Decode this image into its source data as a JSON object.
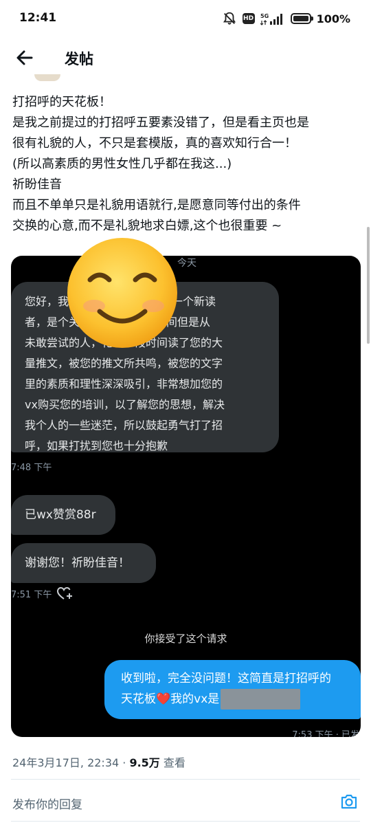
{
  "status_bar": {
    "time": "12:41",
    "network": "5G",
    "battery": "100%",
    "icons": [
      "bell-off-icon",
      "hd-icon",
      "signal-icon",
      "battery-icon"
    ]
  },
  "header": {
    "title": "发帖",
    "back_icon": "arrow-left-icon"
  },
  "post": {
    "text_lines": [
      "打招呼的天花板！",
      "是我之前提过的打招呼五要素没错了，但是看主页也是",
      "很有礼貌的人，不只是套模版，真的喜欢知行合一！",
      "(所以高素质的男性女性几乎都在我这...)",
      "祈盼佳音",
      "而且不单单只是礼貌用语就行,是愿意同等付出的条件",
      "交换的心意,而不是礼貌地求白嫖,这个也很重要 ~"
    ],
    "date": "24年3月17日, 22:34 · ",
    "views_count": "9.5万",
    "views_label": " 查看"
  },
  "chat": {
    "date_label": "今天",
    "message1_lines": [
      "您好，我",
      "者，是个关注",
      "未敢尝试的人，花了一段时间读了您的大",
      "量推文，被您的推文所共鸣，被您的文字",
      "里的素质和理性深深吸引，非常想加您的",
      "vx购买您的培训，以了解您的思想，解决",
      "我个人的一些迷茫，所以鼓起勇气打了招",
      "呼，如果打扰到您也十分抱歉"
    ],
    "message1_fragments": [
      "久的一个新读",
      "关知识很长时间但是从"
    ],
    "message1_time": "7:48 下午",
    "message2": "已wx赞赏88r",
    "message3": "谢谢您！祈盼佳音！",
    "message3_time": "7:51 下午",
    "accepted_notice": "你接受了这个请求",
    "reply_line1": "收到啦，完全没问题！这简直是打招呼的",
    "reply_line2_a": "天花板",
    "reply_heart": "❤️",
    "reply_line2_b": "我的vx是",
    "reply_time": "7:53 下午 · 已发",
    "emoji_icon": "smiling-face-emoji"
  },
  "reply_bar": {
    "placeholder": "发布你的回复",
    "camera_icon": "camera-icon"
  },
  "colors": {
    "accent": "#1d9bf0",
    "chat_bubble": "#2f3336",
    "chat_bg": "#000000",
    "muted": "#536471"
  }
}
